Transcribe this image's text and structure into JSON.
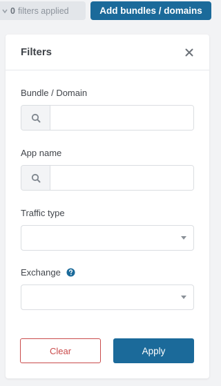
{
  "topbar": {
    "filters_count": "0",
    "filters_text": "filters applied",
    "add_button_label": "Add bundles / domains"
  },
  "panel": {
    "title": "Filters",
    "fields": {
      "bundle_domain": {
        "label": "Bundle / Domain",
        "value": "",
        "placeholder": ""
      },
      "app_name": {
        "label": "App name",
        "value": "",
        "placeholder": ""
      },
      "traffic_type": {
        "label": "Traffic type",
        "selected": ""
      },
      "exchange": {
        "label": "Exchange",
        "selected": ""
      }
    },
    "clear_label": "Clear",
    "apply_label": "Apply"
  },
  "colors": {
    "primary": "#1b6a9a",
    "danger": "#c94a4a",
    "help_icon": "#1b6a9a"
  }
}
